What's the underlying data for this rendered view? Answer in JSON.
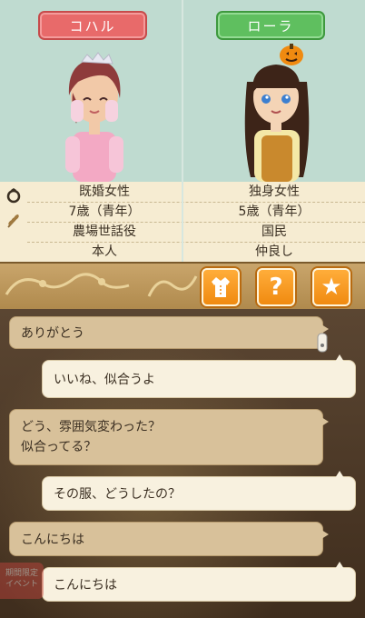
{
  "characters": {
    "left": {
      "name": "コハル",
      "tag_color": "#e86a6a"
    },
    "right": {
      "name": "ローラ",
      "tag_color": "#5fbf5f"
    }
  },
  "info_table": {
    "rows": [
      {
        "icon": "ring-icon",
        "left": "既婚女性",
        "right": "独身女性"
      },
      {
        "icon": "wheat-icon",
        "left": "7歳（青年）",
        "right": "5歳（青年）"
      },
      {
        "icon": "",
        "left": "農場世話役",
        "right": "国民"
      },
      {
        "icon": "",
        "left": "本人",
        "right": "仲良し"
      }
    ]
  },
  "tabs": [
    {
      "name": "outfit-tab",
      "icon": "shirt-icon"
    },
    {
      "name": "help-tab",
      "icon": "question-icon",
      "glyph": "?"
    },
    {
      "name": "favorite-tab",
      "icon": "star-icon",
      "glyph": "★"
    }
  ],
  "chat": [
    {
      "speaker": "kohal",
      "text": "ありがとう"
    },
    {
      "speaker": "me",
      "text": "いいね、似合うよ"
    },
    {
      "speaker": "kohal",
      "lines": [
        "どう、雰囲気変わった？",
        "似合ってる？"
      ]
    },
    {
      "speaker": "me",
      "text": "その服、どうしたの？"
    },
    {
      "speaker": "kohal",
      "text": "こんにちは"
    },
    {
      "speaker": "me",
      "text": "こんにちは"
    }
  ],
  "background_badge": {
    "lines": [
      "期間限定",
      "イベント"
    ]
  },
  "colors": {
    "accent_orange": "#f08a10",
    "panel_bg": "#bfdbd0",
    "table_bg": "#f6ecd2"
  }
}
